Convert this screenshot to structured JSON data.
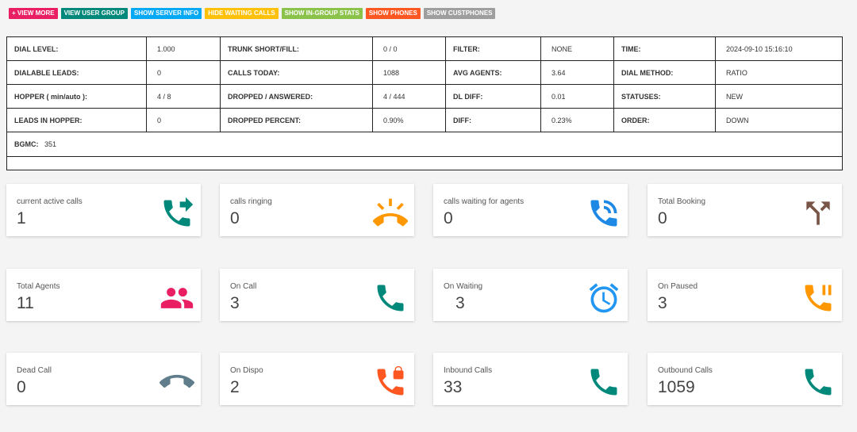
{
  "toolbar": [
    {
      "label": "+ VIEW MORE",
      "color": "#e91e63"
    },
    {
      "label": "VIEW USER GROUP",
      "color": "#00897b"
    },
    {
      "label": "SHOW SERVER INFO",
      "color": "#03a9f4"
    },
    {
      "label": "HIDE WAITING CALLS",
      "color": "#ffc107"
    },
    {
      "label": "SHOW IN-GROUP STATS",
      "color": "#8bc34a"
    },
    {
      "label": "SHOW PHONES",
      "color": "#ff5722"
    },
    {
      "label": "SHOW CUSTPHONES",
      "color": "#9e9e9e"
    }
  ],
  "stats": {
    "rows": [
      [
        [
          "DIAL LEVEL:",
          "1.000"
        ],
        [
          "TRUNK SHORT/FILL:",
          "0 / 0"
        ],
        [
          "FILTER:",
          "NONE"
        ],
        [
          "TIME:",
          "2024-09-10 15:16:10"
        ]
      ],
      [
        [
          "DIALABLE LEADS:",
          "0"
        ],
        [
          "CALLS TODAY:",
          "1088"
        ],
        [
          "AVG AGENTS:",
          "3.64"
        ],
        [
          "DIAL METHOD:",
          "RATIO"
        ]
      ],
      [
        [
          "HOPPER ( min/auto ):",
          "4 / 8"
        ],
        [
          "DROPPED / ANSWERED:",
          "4 / 444"
        ],
        [
          "DL DIFF:",
          "0.01"
        ],
        [
          "STATUSES:",
          "NEW"
        ]
      ],
      [
        [
          "LEADS IN HOPPER:",
          "0"
        ],
        [
          "DROPPED PERCENT:",
          "0.90%"
        ],
        [
          "DIFF:",
          "0.23%"
        ],
        [
          "ORDER:",
          "DOWN"
        ]
      ]
    ],
    "bgmc_label": "BGMC:",
    "bgmc_value": "351"
  },
  "cards": [
    {
      "title": "current active calls",
      "value": "1",
      "icon": "phone-forward-icon",
      "color": "#00897b"
    },
    {
      "title": "calls ringing",
      "value": "0",
      "icon": "phone-ringing-icon",
      "color": "#ff9800"
    },
    {
      "title": "calls waiting for agents",
      "value": "0",
      "icon": "phone-in-talk-icon",
      "color": "#1e88e5"
    },
    {
      "title": "Total Booking",
      "value": "0",
      "icon": "call-split-icon",
      "color": "#795548"
    },
    {
      "title": "Total Agents",
      "value": "11",
      "icon": "people-icon",
      "color": "#e91e63"
    },
    {
      "title": "On Call",
      "value": "3",
      "icon": "phone-icon",
      "color": "#00897b"
    },
    {
      "title": "On Waiting",
      "value": "3",
      "icon": "alarm-clock-icon",
      "color": "#2196f3"
    },
    {
      "title": "On Paused",
      "value": "3",
      "icon": "phone-paused-icon",
      "color": "#ff9800"
    },
    {
      "title": "Dead Call",
      "value": "0",
      "icon": "call-end-icon",
      "color": "#607d8b"
    },
    {
      "title": "On Dispo",
      "value": "2",
      "icon": "phone-locked-icon",
      "color": "#ff5722"
    },
    {
      "title": "Inbound Calls",
      "value": "33",
      "icon": "phone-icon",
      "color": "#00897b"
    },
    {
      "title": "Outbound Calls",
      "value": "1059",
      "icon": "phone-icon",
      "color": "#00897b"
    }
  ]
}
